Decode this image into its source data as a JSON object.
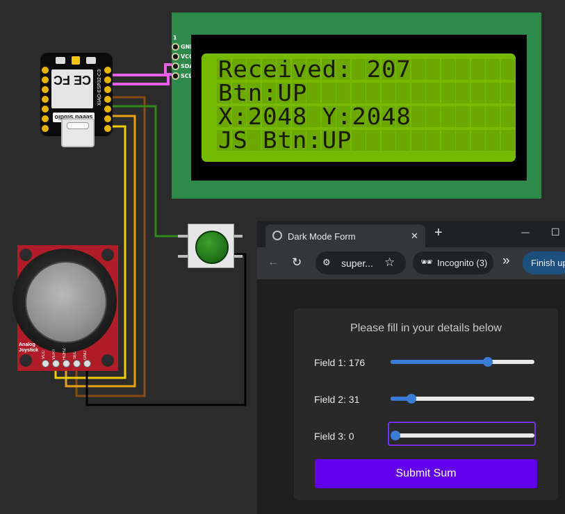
{
  "lcd": {
    "pin_header": "1",
    "pins": [
      "GND",
      "VCC",
      "SDA",
      "SCL"
    ],
    "lines": [
      "Received: 207",
      "Btn:UP",
      "X:2048 Y:2048",
      "JS Btn:UP"
    ]
  },
  "xiao": {
    "brand": "seeed studio",
    "model": "XIAO-ESP32-C3"
  },
  "joystick": {
    "label_line1": "Analog",
    "label_line2": "Joystick",
    "pins": [
      "VCC",
      "VERT",
      "HORZ",
      "SEL",
      "GND"
    ]
  },
  "browser": {
    "tab_title": "Dark Mode Form",
    "new_tab": "+",
    "address_text": "super...",
    "incognito_label": "Incognito (3)",
    "more_label": "»",
    "update_label": "Finish up",
    "minimize": "—",
    "maximize": "☐",
    "close_tab": "✕"
  },
  "form": {
    "heading": "Please fill in your details below",
    "fields": [
      {
        "label": "Field 1: 176",
        "value": 176,
        "max": 255
      },
      {
        "label": "Field 2: 31",
        "value": 31,
        "max": 255
      },
      {
        "label": "Field 3: 0",
        "value": 0,
        "max": 255
      }
    ],
    "submit_label": "Submit Sum"
  },
  "colors": {
    "accent": "#6200ea",
    "slider": "#3a7bd5",
    "lcd_bg": "#76b901",
    "focus_ring": "#7a2ff0"
  }
}
